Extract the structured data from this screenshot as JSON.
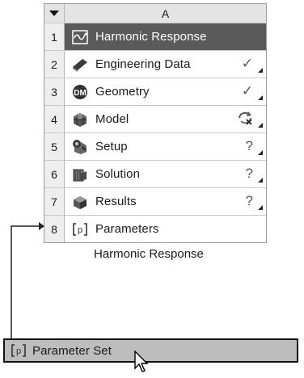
{
  "system": {
    "header": {
      "column": "A"
    },
    "rows": [
      {
        "num": "1",
        "label": "Harmonic Response",
        "icon": "harmonic-response-icon",
        "status": ""
      },
      {
        "num": "2",
        "label": "Engineering Data",
        "icon": "engineering-data-icon",
        "status": "✓"
      },
      {
        "num": "3",
        "label": "Geometry",
        "icon": "geometry-icon",
        "status": "✓"
      },
      {
        "num": "4",
        "label": "Model",
        "icon": "model-icon",
        "status": "update-required-icon"
      },
      {
        "num": "5",
        "label": "Setup",
        "icon": "setup-icon",
        "status": "?"
      },
      {
        "num": "6",
        "label": "Solution",
        "icon": "solution-icon",
        "status": "?"
      },
      {
        "num": "7",
        "label": "Results",
        "icon": "results-icon",
        "status": "?"
      },
      {
        "num": "8",
        "label": "Parameters",
        "icon": "parameters-icon",
        "status": ""
      }
    ],
    "caption": "Harmonic Response",
    "geometry_icon_text": "DM"
  },
  "parameter_set": {
    "label": "Parameter Set",
    "icon": "parameter-set-icon"
  },
  "colors": {
    "selected_row": "#5a5a5a",
    "parameter_bar": "#bdbdbd"
  }
}
